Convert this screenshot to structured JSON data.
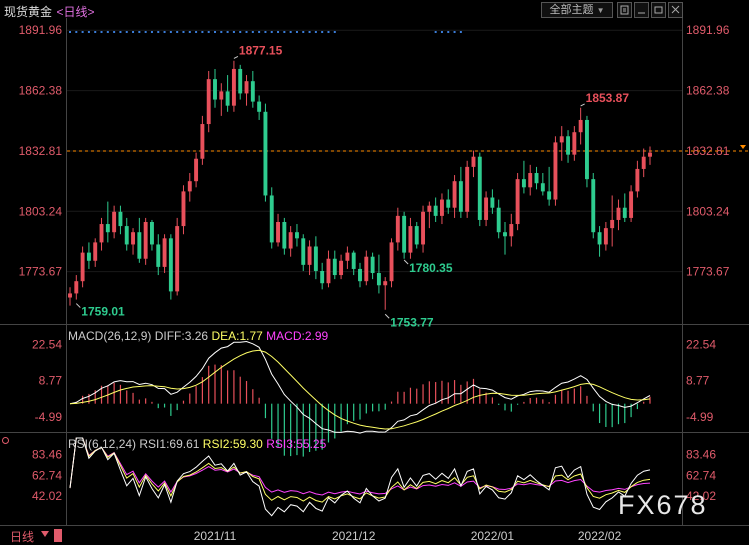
{
  "header": {
    "title": "现货黄金",
    "period": "<日线>",
    "theme_button": "全部主题"
  },
  "toolbar_icons": [
    "chart-settings-icon",
    "minimize-icon",
    "restore-icon",
    "close-icon"
  ],
  "colors": {
    "up": "#e8505b",
    "down": "#2ecc8f",
    "axis_price": "#e05b6b",
    "dif": "#ffffff",
    "dea": "#ffff66",
    "macd": "#ff44ff",
    "rsi1": "#ffffff",
    "rsi2": "#ffff66",
    "rsi3": "#ff44ff",
    "last_price_line": "#ff8c00",
    "dots": "#3b7dd8"
  },
  "watermark": "FX678",
  "footer": {
    "period_label": "日线",
    "dates": [
      "2021/11",
      "2021/12",
      "2022/01",
      "2022/02"
    ]
  },
  "chart_data": [
    {
      "type": "candlestick",
      "name": "现货黄金",
      "y_ticks": [
        "1891.96",
        "1862.38",
        "1832.81",
        "1803.24",
        "1773.67"
      ],
      "ylim": [
        1749,
        1896
      ],
      "last_price": 1832.81,
      "annotations": [
        {
          "text": "1877.15",
          "value": 1877.15,
          "kind": "high"
        },
        {
          "text": "1759.01",
          "value": 1759.01,
          "kind": "low"
        },
        {
          "text": "1753.77",
          "value": 1753.77,
          "kind": "low"
        },
        {
          "text": "1853.87",
          "value": 1853.87,
          "kind": "high"
        },
        {
          "text": "1780.35",
          "value": 1780.35,
          "kind": "low"
        }
      ],
      "candles": [
        [
          1761,
          1766,
          1757,
          1763
        ],
        [
          1763,
          1772,
          1760,
          1769
        ],
        [
          1769,
          1786,
          1766,
          1783
        ],
        [
          1783,
          1788,
          1775,
          1779
        ],
        [
          1779,
          1790,
          1776,
          1788
        ],
        [
          1788,
          1800,
          1784,
          1797
        ],
        [
          1797,
          1808,
          1788,
          1793
        ],
        [
          1793,
          1806,
          1790,
          1803
        ],
        [
          1803,
          1806,
          1792,
          1796
        ],
        [
          1796,
          1800,
          1784,
          1787
        ],
        [
          1787,
          1795,
          1782,
          1793
        ],
        [
          1793,
          1800,
          1778,
          1780
        ],
        [
          1780,
          1800,
          1777,
          1798
        ],
        [
          1798,
          1799,
          1784,
          1787
        ],
        [
          1787,
          1792,
          1772,
          1776
        ],
        [
          1776,
          1792,
          1773,
          1790
        ],
        [
          1790,
          1792,
          1760,
          1764
        ],
        [
          1764,
          1800,
          1762,
          1796
        ],
        [
          1796,
          1816,
          1792,
          1813
        ],
        [
          1813,
          1822,
          1808,
          1818
        ],
        [
          1818,
          1832,
          1815,
          1829
        ],
        [
          1829,
          1850,
          1826,
          1846
        ],
        [
          1846,
          1872,
          1842,
          1868
        ],
        [
          1868,
          1873,
          1854,
          1858
        ],
        [
          1858,
          1866,
          1850,
          1862
        ],
        [
          1862,
          1870,
          1852,
          1855
        ],
        [
          1855,
          1877,
          1852,
          1873
        ],
        [
          1873,
          1875,
          1858,
          1861
        ],
        [
          1861,
          1870,
          1855,
          1867
        ],
        [
          1867,
          1872,
          1854,
          1857
        ],
        [
          1857,
          1860,
          1848,
          1852
        ],
        [
          1852,
          1856,
          1808,
          1811
        ],
        [
          1811,
          1815,
          1785,
          1788
        ],
        [
          1788,
          1802,
          1786,
          1798
        ],
        [
          1798,
          1800,
          1782,
          1785
        ],
        [
          1785,
          1796,
          1781,
          1793
        ],
        [
          1793,
          1797,
          1786,
          1790
        ],
        [
          1790,
          1792,
          1774,
          1777
        ],
        [
          1777,
          1789,
          1772,
          1786
        ],
        [
          1786,
          1791,
          1770,
          1774
        ],
        [
          1774,
          1778,
          1765,
          1768
        ],
        [
          1768,
          1784,
          1766,
          1780
        ],
        [
          1780,
          1784,
          1770,
          1772
        ],
        [
          1772,
          1782,
          1770,
          1779
        ],
        [
          1779,
          1786,
          1775,
          1783
        ],
        [
          1783,
          1784,
          1772,
          1775
        ],
        [
          1775,
          1778,
          1766,
          1769
        ],
        [
          1769,
          1784,
          1767,
          1781
        ],
        [
          1781,
          1783,
          1770,
          1773
        ],
        [
          1773,
          1782,
          1763,
          1767
        ],
        [
          1767,
          1771,
          1755,
          1769
        ],
        [
          1769,
          1790,
          1766,
          1788
        ],
        [
          1788,
          1805,
          1784,
          1801
        ],
        [
          1801,
          1803,
          1780,
          1783
        ],
        [
          1783,
          1800,
          1780,
          1796
        ],
        [
          1796,
          1798,
          1785,
          1787
        ],
        [
          1787,
          1806,
          1783,
          1803
        ],
        [
          1803,
          1808,
          1795,
          1806
        ],
        [
          1806,
          1810,
          1798,
          1801
        ],
        [
          1801,
          1812,
          1797,
          1809
        ],
        [
          1809,
          1814,
          1802,
          1805
        ],
        [
          1805,
          1821,
          1800,
          1818
        ],
        [
          1818,
          1825,
          1800,
          1803
        ],
        [
          1803,
          1828,
          1800,
          1825
        ],
        [
          1825,
          1833,
          1820,
          1830
        ],
        [
          1830,
          1832,
          1796,
          1799
        ],
        [
          1799,
          1813,
          1796,
          1810
        ],
        [
          1810,
          1814,
          1802,
          1805
        ],
        [
          1805,
          1809,
          1790,
          1793
        ],
        [
          1793,
          1798,
          1782,
          1791
        ],
        [
          1791,
          1802,
          1786,
          1797
        ],
        [
          1797,
          1822,
          1794,
          1819
        ],
        [
          1819,
          1828,
          1812,
          1815
        ],
        [
          1815,
          1826,
          1811,
          1822
        ],
        [
          1822,
          1825,
          1814,
          1817
        ],
        [
          1817,
          1822,
          1811,
          1813
        ],
        [
          1813,
          1825,
          1806,
          1809
        ],
        [
          1809,
          1840,
          1806,
          1837
        ],
        [
          1837,
          1845,
          1828,
          1840
        ],
        [
          1840,
          1843,
          1827,
          1831
        ],
        [
          1831,
          1845,
          1828,
          1842
        ],
        [
          1842,
          1854,
          1836,
          1848
        ],
        [
          1848,
          1850,
          1815,
          1819
        ],
        [
          1819,
          1822,
          1790,
          1793
        ],
        [
          1793,
          1796,
          1781,
          1787
        ],
        [
          1787,
          1798,
          1784,
          1795
        ],
        [
          1795,
          1811,
          1786,
          1799
        ],
        [
          1799,
          1809,
          1794,
          1805
        ],
        [
          1805,
          1812,
          1798,
          1800
        ],
        [
          1800,
          1816,
          1798,
          1813
        ],
        [
          1813,
          1828,
          1810,
          1824
        ],
        [
          1824,
          1834,
          1820,
          1830
        ],
        [
          1830,
          1835,
          1826,
          1832
        ]
      ]
    },
    {
      "type": "macd",
      "params": "MACD(26,12,9)",
      "dif": {
        "label": "DIFF",
        "value": "3.26"
      },
      "dea": {
        "label": "DEA",
        "value": "1.77"
      },
      "macd": {
        "label": "MACD",
        "value": "2.99"
      },
      "y_ticks": [
        "22.54",
        "8.77",
        "-4.99"
      ]
    },
    {
      "type": "rsi",
      "params": "RSI(6,12,24)",
      "rsi1": {
        "label": "RSI1",
        "value": "69.61"
      },
      "rsi2": {
        "label": "RSI2",
        "value": "59.30"
      },
      "rsi3": {
        "label": "RSI3",
        "value": "55.25"
      },
      "y_ticks": [
        "83.46",
        "62.74",
        "42.02"
      ]
    }
  ]
}
